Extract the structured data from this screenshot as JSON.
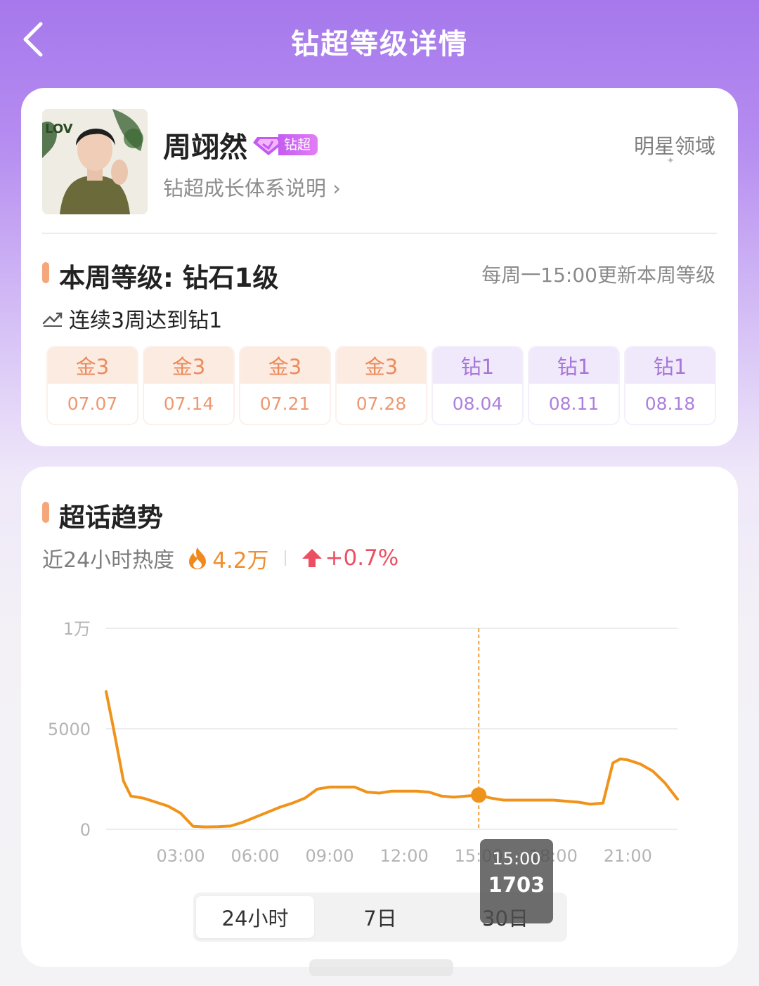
{
  "header": {
    "title": "钻超等级详情"
  },
  "profile": {
    "name": "周翊然",
    "badge": "钻超",
    "growth_link": "钻超成长体系说明 ›",
    "domain": "明星领域"
  },
  "level": {
    "title": "本周等级: 钻石1级",
    "update_note": "每周一15:00更新本周等级",
    "streak": "连续3周达到钻1",
    "weeks": [
      {
        "level": "金3",
        "date": "07.07",
        "tier": "gold"
      },
      {
        "level": "金3",
        "date": "07.14",
        "tier": "gold"
      },
      {
        "level": "金3",
        "date": "07.21",
        "tier": "gold"
      },
      {
        "level": "金3",
        "date": "07.28",
        "tier": "gold"
      },
      {
        "level": "钻1",
        "date": "08.04",
        "tier": "diamond"
      },
      {
        "level": "钻1",
        "date": "08.11",
        "tier": "diamond"
      },
      {
        "level": "钻1",
        "date": "08.18",
        "tier": "diamond"
      }
    ]
  },
  "trend": {
    "title": "超话趋势",
    "heat_label": "近24小时热度",
    "heat_value": "4.2万",
    "heat_change": "+0.7%",
    "range_tabs": [
      "24小时",
      "7日",
      "30日"
    ],
    "active_tab": 0,
    "tooltip": {
      "time": "15:00",
      "value": "1703"
    }
  },
  "chart_data": {
    "type": "line",
    "title": "",
    "xlabel": "",
    "ylabel": "",
    "ylim": [
      0,
      10000
    ],
    "y_ticks": [
      {
        "value": 0,
        "label": "0"
      },
      {
        "value": 5000,
        "label": "5000"
      },
      {
        "value": 10000,
        "label": "1万"
      }
    ],
    "x_tick_labels": [
      "03:00",
      "06:00",
      "09:00",
      "12:00",
      "15:00",
      "18:00",
      "21:00"
    ],
    "xlim": [
      0,
      23
    ],
    "grid": true,
    "color": "#f0931a",
    "highlight": {
      "x": 15,
      "y": 1703
    },
    "series": [
      {
        "x": [
          0,
          0.3,
          0.7,
          1,
          1.5,
          2,
          2.5,
          3,
          3.5,
          4,
          4.5,
          5,
          5.5,
          6,
          6.5,
          7,
          7.5,
          8,
          8.5,
          9,
          9.5,
          10,
          10.5,
          11,
          11.5,
          12,
          12.5,
          13,
          13.5,
          14,
          14.5,
          15,
          15.5,
          16,
          16.5,
          17,
          17.5,
          18,
          18.5,
          19,
          19.5,
          20,
          20.4,
          20.7,
          21,
          21.5,
          22,
          22.5,
          23
        ],
        "y": [
          6850,
          5000,
          2400,
          1650,
          1550,
          1350,
          1150,
          800,
          150,
          120,
          130,
          160,
          350,
          600,
          850,
          1100,
          1300,
          1550,
          2000,
          2100,
          2100,
          2100,
          1850,
          1800,
          1900,
          1900,
          1900,
          1850,
          1650,
          1600,
          1650,
          1703,
          1550,
          1450,
          1450,
          1450,
          1450,
          1450,
          1400,
          1350,
          1250,
          1300,
          3300,
          3500,
          3450,
          3250,
          2900,
          2300,
          1500
        ]
      }
    ]
  }
}
